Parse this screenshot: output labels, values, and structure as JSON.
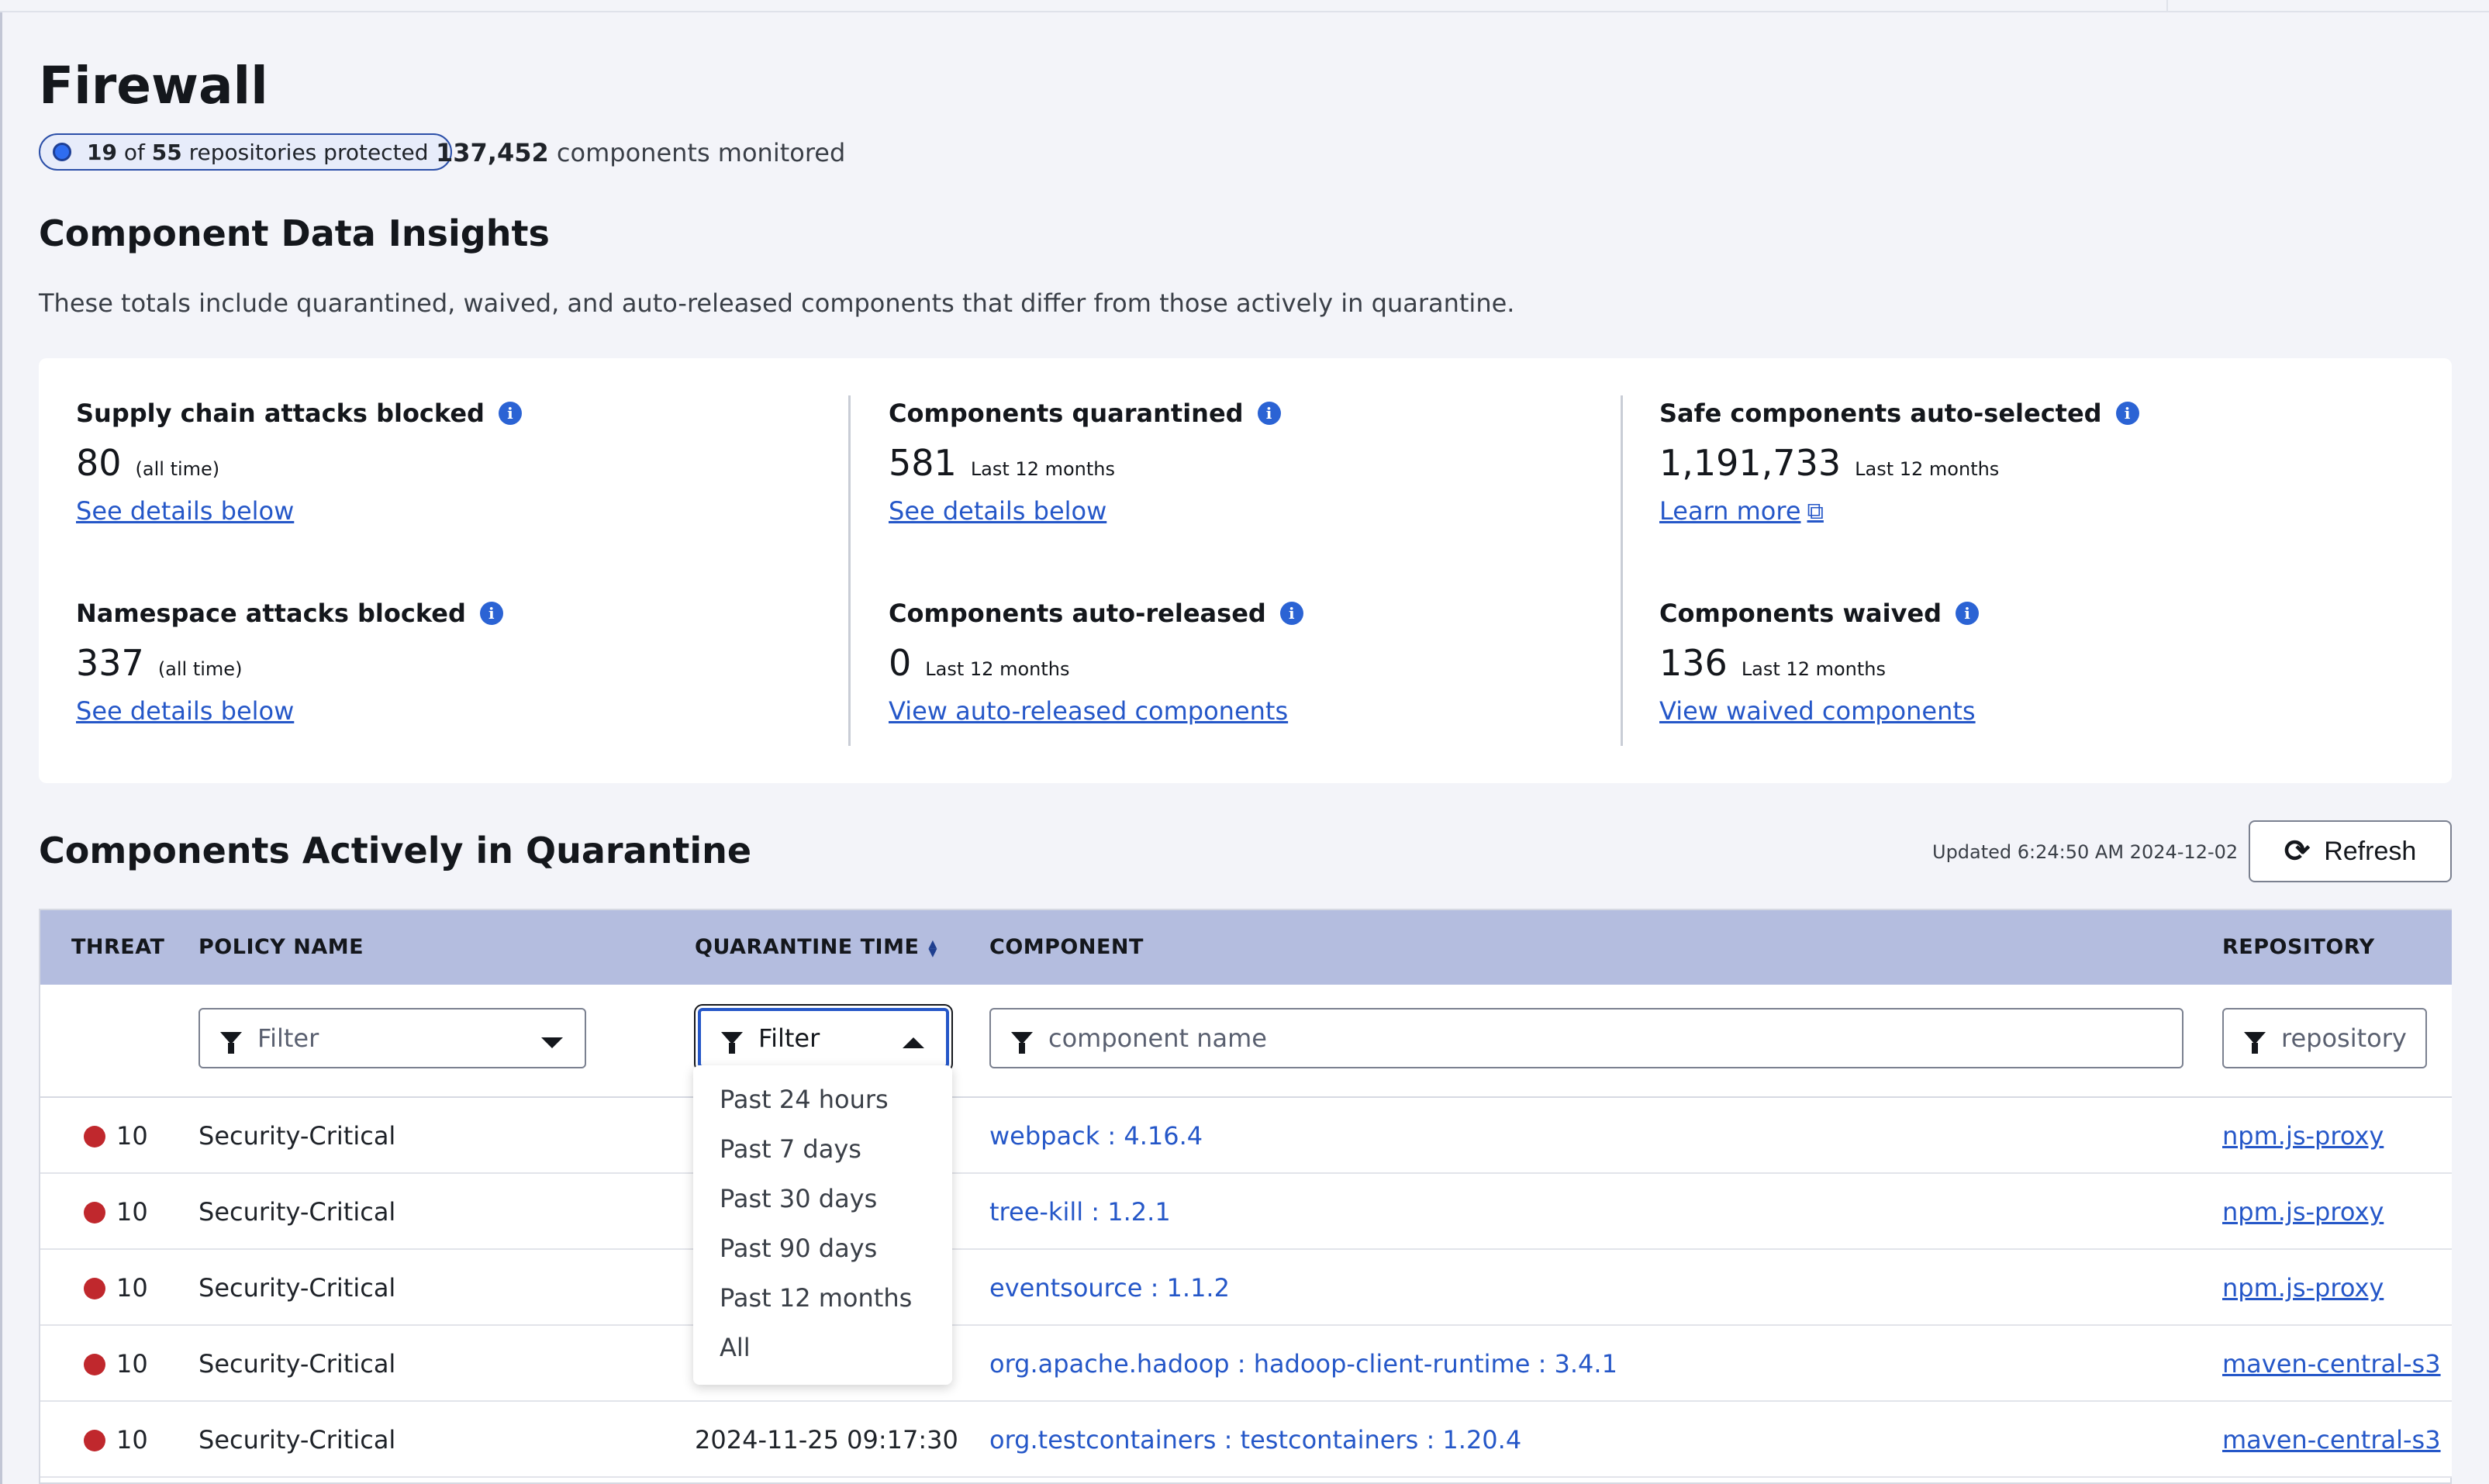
{
  "page": {
    "title": "Firewall",
    "repos_protected": "19",
    "repos_of": "of",
    "repos_total": "55",
    "repos_suffix": "repositories protected",
    "components_monitored_count": "137,452",
    "components_monitored_label": "components monitored"
  },
  "insights": {
    "title": "Component Data Insights",
    "description": "These totals include quarantined, waived, and auto-released components that differ from those actively in quarantine.",
    "metrics": [
      {
        "label": "Supply chain attacks blocked",
        "value": "80",
        "period": "(all time)",
        "link": "See details below"
      },
      {
        "label": "Namespace attacks blocked",
        "value": "337",
        "period": "(all time)",
        "link": "See details below"
      },
      {
        "label": "Components quarantined",
        "value": "581",
        "period": "Last 12 months",
        "link": "See details below"
      },
      {
        "label": "Components auto-released",
        "value": "0",
        "period": "Last 12 months",
        "link": "View auto-released components"
      },
      {
        "label": "Safe components auto-selected",
        "value": "1,191,733",
        "period": "Last 12 months",
        "link": "Learn more"
      },
      {
        "label": "Components waived",
        "value": "136",
        "period": "Last 12 months",
        "link": "View waived components"
      }
    ]
  },
  "quarantine": {
    "title": "Components Actively in Quarantine",
    "updated": "Updated 6:24:50 AM 2024-12-02",
    "refresh_label": "Refresh",
    "columns": {
      "threat": "THREAT",
      "policy": "POLICY NAME",
      "time": "QUARANTINE TIME",
      "component": "COMPONENT",
      "repository": "REPOSITORY"
    },
    "filters": {
      "policy": "Filter",
      "time": "Filter",
      "component_placeholder": "component name",
      "repository_placeholder": "repository"
    },
    "time_options": [
      "Past 24 hours",
      "Past 7 days",
      "Past 30 days",
      "Past 90 days",
      "Past 12 months",
      "All"
    ],
    "rows": [
      {
        "threat": "10",
        "policy": "Security-Critical",
        "time": "",
        "component": "webpack : 4.16.4",
        "repository": "npm.js-proxy"
      },
      {
        "threat": "10",
        "policy": "Security-Critical",
        "time": "",
        "component": "tree-kill : 1.2.1",
        "repository": "npm.js-proxy"
      },
      {
        "threat": "10",
        "policy": "Security-Critical",
        "time": "",
        "component": "eventsource : 1.1.2",
        "repository": "npm.js-proxy"
      },
      {
        "threat": "10",
        "policy": "Security-Critical",
        "time": "",
        "component": "org.apache.hadoop : hadoop-client-runtime : 3.4.1",
        "repository": "maven-central-s3"
      },
      {
        "threat": "10",
        "policy": "Security-Critical",
        "time": "2024-11-25 09:17:30",
        "component": "org.testcontainers : testcontainers : 1.20.4",
        "repository": "maven-central-s3"
      }
    ]
  },
  "colors": {
    "accent": "#2557c8",
    "header_bg": "#b4bddf",
    "threat_critical": "#c0282d",
    "page_bg": "#f3f4f9"
  }
}
